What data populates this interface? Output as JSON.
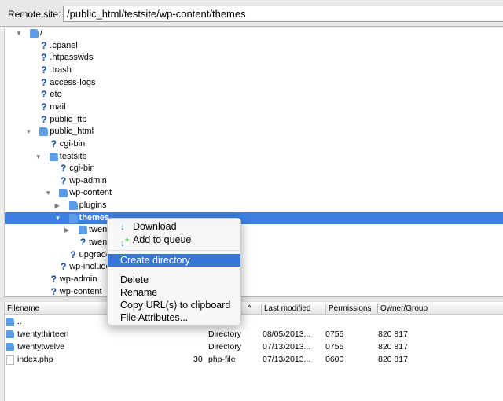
{
  "remote_site": {
    "label": "Remote site:",
    "path": "/public_html/testsite/wp-content/themes"
  },
  "tree": [
    {
      "name": "/",
      "level": 0,
      "type": "folder",
      "expanded": true
    },
    {
      "name": ".cpanel",
      "level": 1,
      "type": "unknown"
    },
    {
      "name": ".htpasswds",
      "level": 1,
      "type": "unknown"
    },
    {
      "name": ".trash",
      "level": 1,
      "type": "unknown"
    },
    {
      "name": "access-logs",
      "level": 1,
      "type": "unknown"
    },
    {
      "name": "etc",
      "level": 1,
      "type": "unknown"
    },
    {
      "name": "mail",
      "level": 1,
      "type": "unknown"
    },
    {
      "name": "public_ftp",
      "level": 1,
      "type": "unknown"
    },
    {
      "name": "public_html",
      "level": 1,
      "type": "folder",
      "expanded": true
    },
    {
      "name": "cgi-bin",
      "level": 2,
      "type": "unknown"
    },
    {
      "name": "testsite",
      "level": 2,
      "type": "folder",
      "expanded": true
    },
    {
      "name": "cgi-bin",
      "level": 3,
      "type": "unknown"
    },
    {
      "name": "wp-admin",
      "level": 3,
      "type": "unknown"
    },
    {
      "name": "wp-content",
      "level": 3,
      "type": "folder",
      "expanded": true
    },
    {
      "name": "plugins",
      "level": 4,
      "type": "folder",
      "expanded": false
    },
    {
      "name": "themes",
      "level": 4,
      "type": "folder",
      "expanded": true,
      "selected": true
    },
    {
      "name": "twent",
      "level": 5,
      "type": "folder",
      "expanded": false
    },
    {
      "name": "twent",
      "level": 5,
      "type": "unknown"
    },
    {
      "name": "upgrade",
      "level": 4,
      "type": "unknown"
    },
    {
      "name": "wp-include",
      "level": 3,
      "type": "unknown"
    },
    {
      "name": "wp-admin",
      "level": 2,
      "type": "unknown"
    },
    {
      "name": "wp-content",
      "level": 2,
      "type": "unknown"
    }
  ],
  "file_list": {
    "columns": [
      "Filename",
      "Last modified",
      "Permissions",
      "Owner/Group"
    ],
    "sort_indicator": "^",
    "rows": [
      {
        "name": "..",
        "size": "",
        "type": "",
        "modified": "",
        "perms": "",
        "owner": "",
        "icon": "folder"
      },
      {
        "name": "twentythirteen",
        "size": "",
        "type": "Directory",
        "modified": "08/05/2013...",
        "perms": "0755",
        "owner": "820 817",
        "icon": "folder"
      },
      {
        "name": "twentytwelve",
        "size": "",
        "type": "Directory",
        "modified": "07/13/2013...",
        "perms": "0755",
        "owner": "820 817",
        "icon": "folder"
      },
      {
        "name": "index.php",
        "size": "30",
        "type": "php-file",
        "modified": "07/13/2013...",
        "perms": "0600",
        "owner": "820 817",
        "icon": "file"
      }
    ]
  },
  "context_menu": {
    "download": "Download",
    "add_to_queue": "Add to queue",
    "create_directory": "Create directory",
    "delete": "Delete",
    "rename": "Rename",
    "copy_url": "Copy URL(s) to clipboard",
    "file_attributes": "File Attributes..."
  },
  "colors": {
    "selection": "#3d80df",
    "menu_highlight": "#3875d7",
    "folder": "#5c9be6"
  }
}
